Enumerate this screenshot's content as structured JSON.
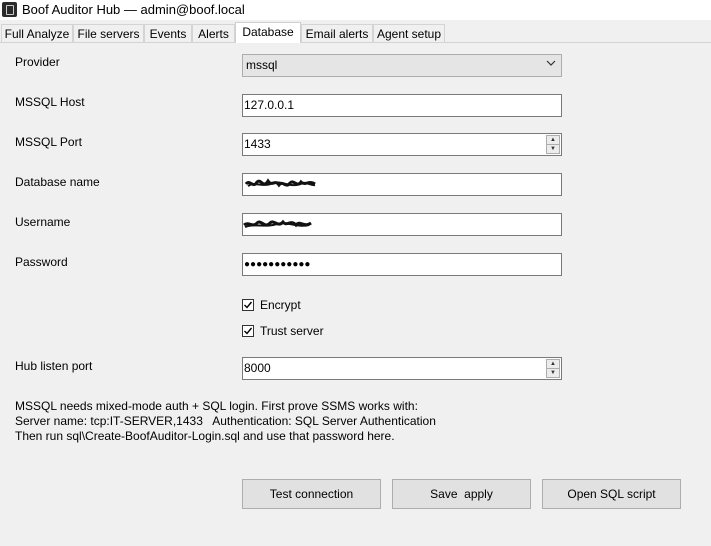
{
  "window": {
    "title": "Boof Auditor Hub — admin@boof.local"
  },
  "tabs": [
    {
      "label": "Full Analyze"
    },
    {
      "label": "File servers"
    },
    {
      "label": "Events"
    },
    {
      "label": "Alerts"
    },
    {
      "label": "Database",
      "active": true
    },
    {
      "label": "Email alerts"
    },
    {
      "label": "Agent setup"
    }
  ],
  "form": {
    "provider": {
      "label": "Provider",
      "value": "mssql"
    },
    "host": {
      "label": "MSSQL Host",
      "value": "127.0.0.1"
    },
    "port": {
      "label": "MSSQL Port",
      "value": "1433"
    },
    "dbname": {
      "label": "Database name"
    },
    "username": {
      "label": "Username"
    },
    "password": {
      "label": "Password",
      "value": "●●●●●●●●●●●"
    },
    "encrypt": {
      "label": "Encrypt",
      "checked": true
    },
    "trust": {
      "label": "Trust server",
      "checked": true
    },
    "listen_port": {
      "label": "Hub listen port",
      "value": "8000"
    }
  },
  "note": {
    "line1": "MSSQL needs mixed-mode auth + SQL login. First prove SSMS works with:",
    "line2": "Server name: tcp:IT-SERVER,1433   Authentication: SQL Server Authentication",
    "line3": "Then run sql\\Create-BoofAuditor-Login.sql and use that password here."
  },
  "buttons": {
    "test": "Test connection",
    "save": "Save  apply",
    "open_sql": "Open SQL script"
  }
}
